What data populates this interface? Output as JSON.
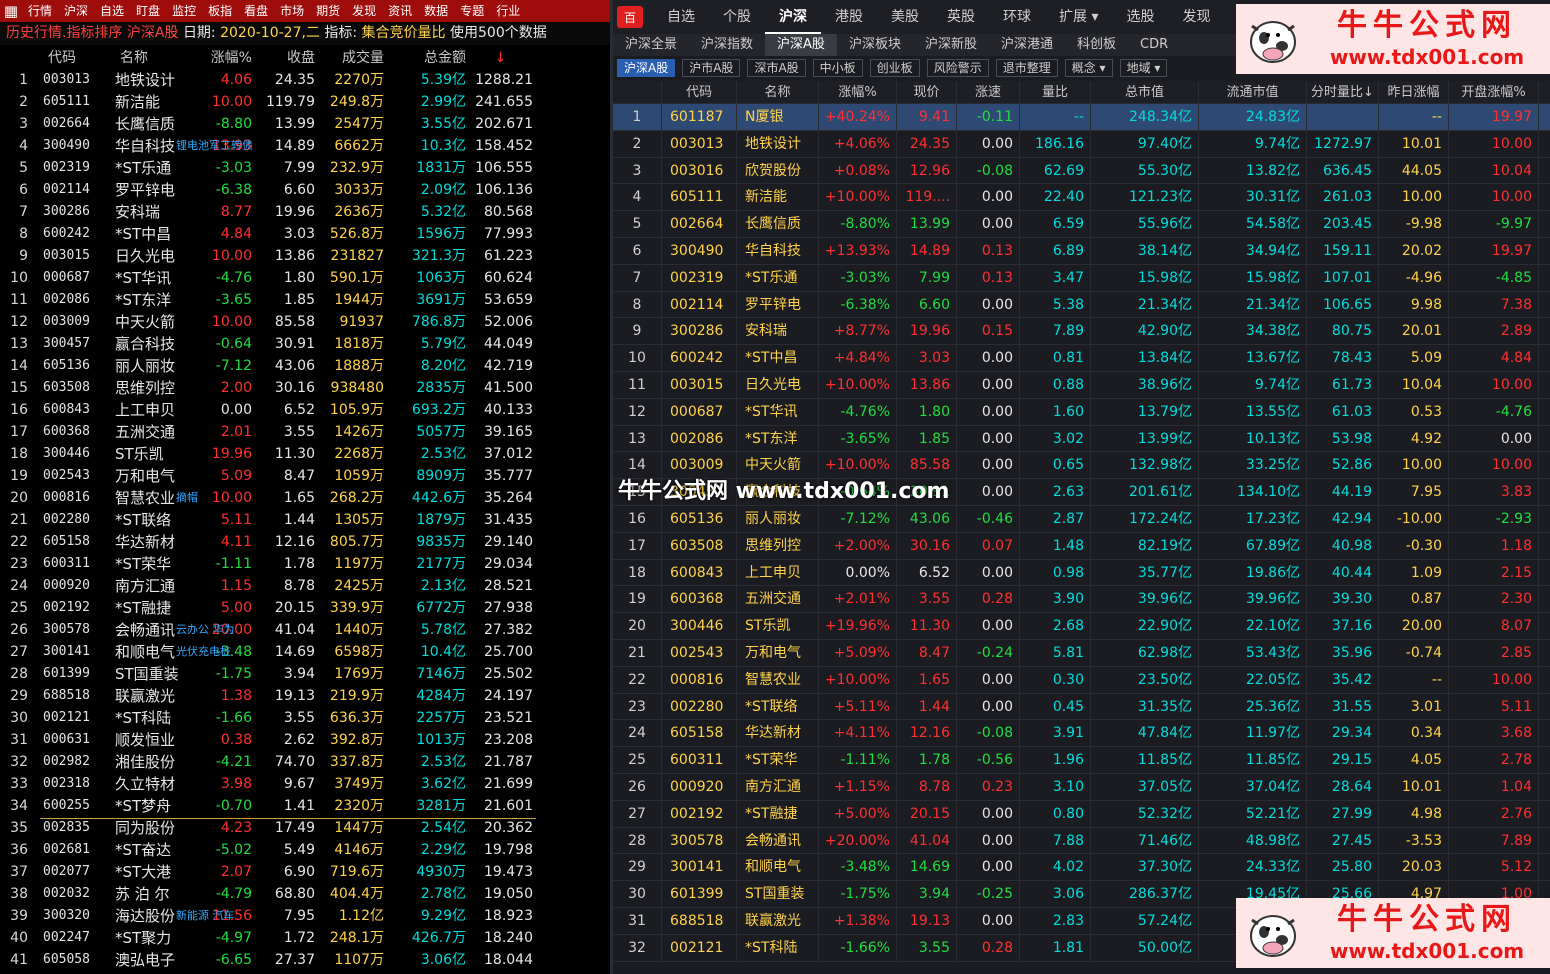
{
  "left_menu": {
    "items": [
      "行情",
      "沪深",
      "自选",
      "盯盘",
      "监控",
      "板指",
      "看盘",
      "市场",
      "期货",
      "发现",
      "资讯",
      "数据",
      "专题",
      "行业"
    ]
  },
  "left_title": {
    "part1": "历史行情.指标排序 沪深A股",
    "part2": "日期:",
    "date": "2020-10-27,二",
    "part3": "指标:",
    "indicator": "集合竞价量比",
    "part4": "使用500个数据"
  },
  "left_header": {
    "code": "代码",
    "name": "名称",
    "pct": "涨幅%",
    "price": "收盘",
    "vol": "成交量",
    "amt": "总金额",
    "sort": "↓"
  },
  "left_rows": [
    [
      "1",
      "003013",
      "地铁设计",
      "4.06",
      "24.35",
      "2270万",
      "5.39亿",
      "1288.21",
      "up",
      ""
    ],
    [
      "2",
      "605111",
      "新洁能",
      "10.00",
      "119.79",
      "249.8万",
      "2.99亿",
      "241.655",
      "up",
      ""
    ],
    [
      "3",
      "002664",
      "长鹰信质",
      "-8.80",
      "13.99",
      "2547万",
      "3.55亿",
      "202.671",
      "down",
      ""
    ],
    [
      "4",
      "300490",
      "华自科技",
      "13.93",
      "14.89",
      "6662万",
      "10.3亿",
      "158.452",
      "up",
      "锂电池军工转债"
    ],
    [
      "5",
      "002319",
      "*ST乐通",
      "-3.03",
      "7.99",
      "232.9万",
      "1831万",
      "106.555",
      "down",
      ""
    ],
    [
      "6",
      "002114",
      "罗平锌电",
      "-6.38",
      "6.60",
      "3033万",
      "2.09亿",
      "106.136",
      "down",
      ""
    ],
    [
      "7",
      "300286",
      "安科瑞",
      "8.77",
      "19.96",
      "2636万",
      "5.32亿",
      "80.568",
      "up",
      ""
    ],
    [
      "8",
      "600242",
      "*ST中昌",
      "4.84",
      "3.03",
      "526.8万",
      "1596万",
      "77.993",
      "up",
      ""
    ],
    [
      "9",
      "003015",
      "日久光电",
      "10.00",
      "13.86",
      "231827",
      "321.3万",
      "61.223",
      "up",
      ""
    ],
    [
      "10",
      "000687",
      "*ST华讯",
      "-4.76",
      "1.80",
      "590.1万",
      "1063万",
      "60.624",
      "down",
      ""
    ],
    [
      "11",
      "002086",
      "*ST东洋",
      "-3.65",
      "1.85",
      "1944万",
      "3691万",
      "53.659",
      "down",
      ""
    ],
    [
      "12",
      "003009",
      "中天火箭",
      "10.00",
      "85.58",
      "91937",
      "786.8万",
      "52.006",
      "up",
      ""
    ],
    [
      "13",
      "300457",
      "赢合科技",
      "-0.64",
      "30.91",
      "1818万",
      "5.79亿",
      "44.049",
      "down",
      ""
    ],
    [
      "14",
      "605136",
      "丽人丽妆",
      "-7.12",
      "43.06",
      "1888万",
      "8.20亿",
      "42.719",
      "down",
      ""
    ],
    [
      "15",
      "603508",
      "思维列控",
      "2.00",
      "30.16",
      "938480",
      "2835万",
      "41.500",
      "up",
      ""
    ],
    [
      "16",
      "600843",
      "上工申贝",
      "0.00",
      "6.52",
      "105.9万",
      "693.2万",
      "40.133",
      "flat",
      ""
    ],
    [
      "17",
      "600368",
      "五洲交通",
      "2.01",
      "3.55",
      "1426万",
      "5057万",
      "39.165",
      "up",
      ""
    ],
    [
      "18",
      "300446",
      "ST乐凯",
      "19.96",
      "11.30",
      "2268万",
      "2.53亿",
      "37.012",
      "up",
      ""
    ],
    [
      "19",
      "002543",
      "万和电气",
      "5.09",
      "8.47",
      "1059万",
      "8909万",
      "35.777",
      "up",
      ""
    ],
    [
      "20",
      "000816",
      "智慧农业",
      "10.00",
      "1.65",
      "268.2万",
      "442.6万",
      "35.264",
      "up",
      "摘帽"
    ],
    [
      "21",
      "002280",
      "*ST联络",
      "5.11",
      "1.44",
      "1305万",
      "1879万",
      "31.435",
      "up",
      ""
    ],
    [
      "22",
      "605158",
      "华达新材",
      "4.11",
      "12.16",
      "805.7万",
      "9835万",
      "29.140",
      "up",
      ""
    ],
    [
      "23",
      "600311",
      "*ST荣华",
      "-1.11",
      "1.78",
      "1197万",
      "2177万",
      "29.034",
      "down",
      ""
    ],
    [
      "24",
      "000920",
      "南方汇通",
      "1.15",
      "8.78",
      "2425万",
      "2.13亿",
      "28.521",
      "up",
      ""
    ],
    [
      "25",
      "002192",
      "*ST融捷",
      "5.00",
      "20.15",
      "339.9万",
      "6772万",
      "27.938",
      "up",
      ""
    ],
    [
      "26",
      "300578",
      "会畅通讯",
      "20.00",
      "41.04",
      "1440万",
      "5.78亿",
      "27.382",
      "up",
      "云办公 华为"
    ],
    [
      "27",
      "300141",
      "和顺电气",
      "-3.48",
      "14.69",
      "6598万",
      "10.4亿",
      "25.700",
      "down",
      "光伏充电桩"
    ],
    [
      "28",
      "601399",
      "ST国重装",
      "-1.75",
      "3.94",
      "1769万",
      "7146万",
      "25.502",
      "down",
      ""
    ],
    [
      "29",
      "688518",
      "联赢激光",
      "1.38",
      "19.13",
      "219.9万",
      "4284万",
      "24.197",
      "up",
      ""
    ],
    [
      "30",
      "002121",
      "*ST科陆",
      "-1.66",
      "3.55",
      "636.3万",
      "2257万",
      "23.521",
      "down",
      ""
    ],
    [
      "31",
      "000631",
      "顺发恒业",
      "0.38",
      "2.62",
      "392.8万",
      "1013万",
      "23.208",
      "up",
      ""
    ],
    [
      "32",
      "002982",
      "湘佳股份",
      "-4.21",
      "74.70",
      "337.8万",
      "2.53亿",
      "21.787",
      "down",
      ""
    ],
    [
      "33",
      "002318",
      "久立特材",
      "3.98",
      "9.67",
      "3749万",
      "3.62亿",
      "21.699",
      "up",
      ""
    ],
    [
      "34",
      "600255",
      "*ST梦舟",
      "-0.70",
      "1.41",
      "2320万",
      "3281万",
      "21.601",
      "down",
      ""
    ],
    [
      "35",
      "002835",
      "同为股份",
      "4.23",
      "17.49",
      "1447万",
      "2.54亿",
      "20.362",
      "up",
      ""
    ],
    [
      "36",
      "002681",
      "*ST奋达",
      "-5.02",
      "5.49",
      "4146万",
      "2.29亿",
      "19.798",
      "down",
      ""
    ],
    [
      "37",
      "002077",
      "*ST大港",
      "2.07",
      "6.90",
      "719.6万",
      "4930万",
      "19.473",
      "up",
      ""
    ],
    [
      "38",
      "002032",
      "苏 泊 尔",
      "-4.79",
      "68.80",
      "404.4万",
      "2.78亿",
      "19.050",
      "down",
      ""
    ],
    [
      "39",
      "300320",
      "海达股份",
      "11.56",
      "7.95",
      "1.12亿",
      "9.29亿",
      "18.923",
      "up",
      "新能源 汽车"
    ],
    [
      "40",
      "002247",
      "*ST聚力",
      "-4.97",
      "1.72",
      "248.1万",
      "426.7万",
      "18.240",
      "down",
      ""
    ],
    [
      "41",
      "605058",
      "澳弘电子",
      "-6.65",
      "27.37",
      "1107万",
      "3.06亿",
      "18.044",
      "down",
      ""
    ]
  ],
  "right_top": {
    "logo": "百",
    "tabs": [
      "自选",
      "个股",
      "沪深",
      "港股",
      "美股",
      "英股",
      "环球",
      "扩展 ▾",
      "选股",
      "发现"
    ],
    "active": 2
  },
  "right_sub": {
    "tabs": [
      "沪深全景",
      "沪深指数",
      "沪深A股",
      "沪深板块",
      "沪深新股",
      "沪深港通",
      "科创板",
      "CDR"
    ],
    "active": 2
  },
  "right_filter": {
    "tabs": [
      "沪深A股",
      "沪市A股",
      "深市A股",
      "中小板",
      "创业板",
      "风险警示",
      "退市整理",
      "概念 ▾",
      "地域 ▾"
    ],
    "active": 0
  },
  "right_header": [
    "",
    "代码",
    "名称",
    "涨幅%",
    "现价",
    "涨速",
    "量比",
    "总市值",
    "流通市值",
    "分时量比↓",
    "昨日涨幅",
    "开盘涨幅%"
  ],
  "right_rows": [
    [
      "1",
      "601187",
      "N厦银",
      "+40.24%",
      "9.41",
      "-0.11",
      "--",
      "248.34亿",
      "24.83亿",
      "",
      "--",
      "19.97",
      "up",
      "down",
      "up"
    ],
    [
      "2",
      "003013",
      "地铁设计",
      "+4.06%",
      "24.35",
      "0.00",
      "186.16",
      "97.40亿",
      "9.74亿",
      "1272.97",
      "10.01",
      "10.00",
      "up",
      "flat",
      "up"
    ],
    [
      "3",
      "003016",
      "欣贺股份",
      "+0.08%",
      "12.96",
      "-0.08",
      "62.69",
      "55.30亿",
      "13.82亿",
      "636.45",
      "44.05",
      "10.04",
      "up",
      "down",
      "up"
    ],
    [
      "4",
      "605111",
      "新洁能",
      "+10.00%",
      "119....",
      "0.00",
      "22.40",
      "121.23亿",
      "30.31亿",
      "261.03",
      "10.00",
      "10.00",
      "up",
      "flat",
      "up"
    ],
    [
      "5",
      "002664",
      "长鹰信质",
      "-8.80%",
      "13.99",
      "0.00",
      "6.59",
      "55.96亿",
      "54.58亿",
      "203.45",
      "-9.98",
      "-9.97",
      "down",
      "flat",
      "down"
    ],
    [
      "6",
      "300490",
      "华自科技",
      "+13.93%",
      "14.89",
      "0.13",
      "6.89",
      "38.14亿",
      "34.94亿",
      "159.11",
      "20.02",
      "19.97",
      "up",
      "up",
      "up"
    ],
    [
      "7",
      "002319",
      "*ST乐通",
      "-3.03%",
      "7.99",
      "0.13",
      "3.47",
      "15.98亿",
      "15.98亿",
      "107.01",
      "-4.96",
      "-4.85",
      "down",
      "up",
      "down"
    ],
    [
      "8",
      "002114",
      "罗平锌电",
      "-6.38%",
      "6.60",
      "0.00",
      "5.38",
      "21.34亿",
      "21.34亿",
      "106.65",
      "9.98",
      "7.38",
      "down",
      "flat",
      "up"
    ],
    [
      "9",
      "300286",
      "安科瑞",
      "+8.77%",
      "19.96",
      "0.15",
      "7.89",
      "42.90亿",
      "34.38亿",
      "80.75",
      "20.01",
      "2.89",
      "up",
      "up",
      "up"
    ],
    [
      "10",
      "600242",
      "*ST中昌",
      "+4.84%",
      "3.03",
      "0.00",
      "0.81",
      "13.84亿",
      "13.67亿",
      "78.43",
      "5.09",
      "4.84",
      "up",
      "flat",
      "up"
    ],
    [
      "11",
      "003015",
      "日久光电",
      "+10.00%",
      "13.86",
      "0.00",
      "0.88",
      "38.96亿",
      "9.74亿",
      "61.73",
      "10.04",
      "10.00",
      "up",
      "flat",
      "up"
    ],
    [
      "12",
      "000687",
      "*ST华讯",
      "-4.76%",
      "1.80",
      "0.00",
      "1.60",
      "13.79亿",
      "13.55亿",
      "61.03",
      "0.53",
      "-4.76",
      "down",
      "flat",
      "down"
    ],
    [
      "13",
      "002086",
      "*ST东洋",
      "-3.65%",
      "1.85",
      "0.00",
      "3.02",
      "13.99亿",
      "10.13亿",
      "53.98",
      "4.92",
      "0.00",
      "down",
      "flat",
      "flat"
    ],
    [
      "14",
      "003009",
      "中天火箭",
      "+10.00%",
      "85.58",
      "0.00",
      "0.65",
      "132.98亿",
      "33.25亿",
      "52.86",
      "10.00",
      "10.00",
      "up",
      "flat",
      "up"
    ],
    [
      "15",
      "300457",
      "赢合科技",
      "-0.64%",
      "30.91",
      "0.00",
      "2.63",
      "201.61亿",
      "134.10亿",
      "44.19",
      "7.95",
      "3.83",
      "down",
      "flat",
      "up"
    ],
    [
      "16",
      "605136",
      "丽人丽妆",
      "-7.12%",
      "43.06",
      "-0.46",
      "2.87",
      "172.24亿",
      "17.23亿",
      "42.94",
      "-10.00",
      "-2.93",
      "down",
      "down",
      "down"
    ],
    [
      "17",
      "603508",
      "思维列控",
      "+2.00%",
      "30.16",
      "0.07",
      "1.48",
      "82.19亿",
      "67.89亿",
      "40.98",
      "-0.30",
      "1.18",
      "up",
      "up",
      "up"
    ],
    [
      "18",
      "600843",
      "上工申贝",
      "0.00%",
      "6.52",
      "0.00",
      "0.98",
      "35.77亿",
      "19.86亿",
      "40.44",
      "1.09",
      "2.15",
      "flat",
      "flat",
      "up"
    ],
    [
      "19",
      "600368",
      "五洲交通",
      "+2.01%",
      "3.55",
      "0.28",
      "3.90",
      "39.96亿",
      "39.96亿",
      "39.30",
      "0.87",
      "2.30",
      "up",
      "up",
      "up"
    ],
    [
      "20",
      "300446",
      "ST乐凯",
      "+19.96%",
      "11.30",
      "0.00",
      "2.68",
      "22.90亿",
      "22.10亿",
      "37.16",
      "20.00",
      "8.07",
      "up",
      "flat",
      "up"
    ],
    [
      "21",
      "002543",
      "万和电气",
      "+5.09%",
      "8.47",
      "-0.24",
      "5.81",
      "62.98亿",
      "53.43亿",
      "35.96",
      "-0.74",
      "2.85",
      "up",
      "down",
      "up"
    ],
    [
      "22",
      "000816",
      "智慧农业",
      "+10.00%",
      "1.65",
      "0.00",
      "0.30",
      "23.50亿",
      "22.05亿",
      "35.42",
      "--",
      "10.00",
      "up",
      "flat",
      "up"
    ],
    [
      "23",
      "002280",
      "*ST联络",
      "+5.11%",
      "1.44",
      "0.00",
      "0.45",
      "31.35亿",
      "25.36亿",
      "31.55",
      "3.01",
      "5.11",
      "up",
      "flat",
      "up"
    ],
    [
      "24",
      "605158",
      "华达新材",
      "+4.11%",
      "12.16",
      "-0.08",
      "3.91",
      "47.84亿",
      "11.97亿",
      "29.34",
      "0.34",
      "3.68",
      "up",
      "down",
      "up"
    ],
    [
      "25",
      "600311",
      "*ST荣华",
      "-1.11%",
      "1.78",
      "-0.56",
      "1.96",
      "11.85亿",
      "11.85亿",
      "29.15",
      "4.05",
      "2.78",
      "down",
      "down",
      "up"
    ],
    [
      "26",
      "000920",
      "南方汇通",
      "+1.15%",
      "8.78",
      "0.23",
      "3.10",
      "37.05亿",
      "37.04亿",
      "28.64",
      "10.01",
      "1.04",
      "up",
      "up",
      "up"
    ],
    [
      "27",
      "002192",
      "*ST融捷",
      "+5.00%",
      "20.15",
      "0.00",
      "0.80",
      "52.32亿",
      "52.21亿",
      "27.99",
      "4.98",
      "2.76",
      "up",
      "flat",
      "up"
    ],
    [
      "28",
      "300578",
      "会畅通讯",
      "+20.00%",
      "41.04",
      "0.00",
      "7.88",
      "71.46亿",
      "48.98亿",
      "27.45",
      "-3.53",
      "7.89",
      "up",
      "flat",
      "up"
    ],
    [
      "29",
      "300141",
      "和顺电气",
      "-3.48%",
      "14.69",
      "0.00",
      "4.02",
      "37.30亿",
      "24.33亿",
      "25.80",
      "20.03",
      "5.12",
      "down",
      "flat",
      "up"
    ],
    [
      "30",
      "601399",
      "ST国重装",
      "-1.75%",
      "3.94",
      "-0.25",
      "3.06",
      "286.37亿",
      "19.45亿",
      "25.66",
      "4.97",
      "1.00",
      "down",
      "down",
      "up"
    ],
    [
      "31",
      "688518",
      "联赢激光",
      "+1.38%",
      "19.13",
      "0.00",
      "2.83",
      "57.24亿",
      "",
      "",
      "",
      "",
      "up",
      "flat",
      "up"
    ],
    [
      "32",
      "002121",
      "*ST科陆",
      "-1.66%",
      "3.55",
      "0.28",
      "1.81",
      "50.00亿",
      "",
      "",
      "",
      "",
      "down",
      "up",
      "up"
    ]
  ],
  "watermarks": {
    "t1": "牛牛公式网",
    "t2": "www.tdx001.com",
    "mid": "牛牛公式网 www.tdx001.com"
  },
  "colors": {
    "up": "#ff3030",
    "down": "#20dd40",
    "accent": "#ffd24a",
    "cyan": "#00dddd"
  }
}
